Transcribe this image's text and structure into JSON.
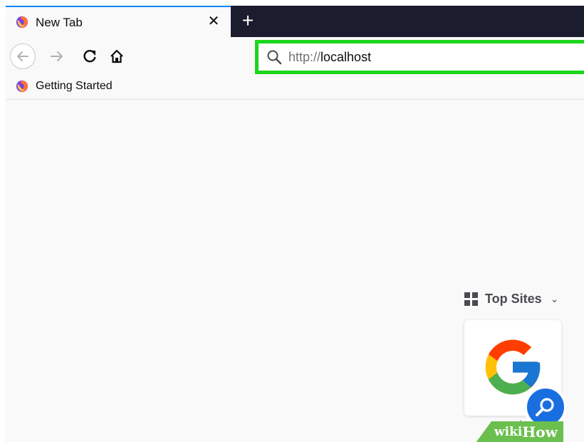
{
  "tab": {
    "title": "New Tab",
    "close_glyph": "✕"
  },
  "new_tab_glyph": "+",
  "urlbar": {
    "scheme": "http://",
    "host": "localhost"
  },
  "bookmarks": [
    {
      "label": "Getting Started"
    }
  ],
  "top_sites": {
    "header": "Top Sites",
    "chevron": "⌄",
    "tiles": [
      {
        "label": "google"
      }
    ]
  },
  "watermark": {
    "wiki": "wiki",
    "how": "How"
  },
  "colors": {
    "highlight": "#1bd61b",
    "tabstrip": "#1b1c2e",
    "accent": "#0a84ff",
    "badge": "#1a6fe0"
  },
  "icons": [
    "firefox-icon",
    "back-arrow-icon",
    "forward-arrow-icon",
    "reload-icon",
    "home-icon",
    "search-icon",
    "grid-icon",
    "google-g-icon",
    "magnifier-badge-icon"
  ]
}
